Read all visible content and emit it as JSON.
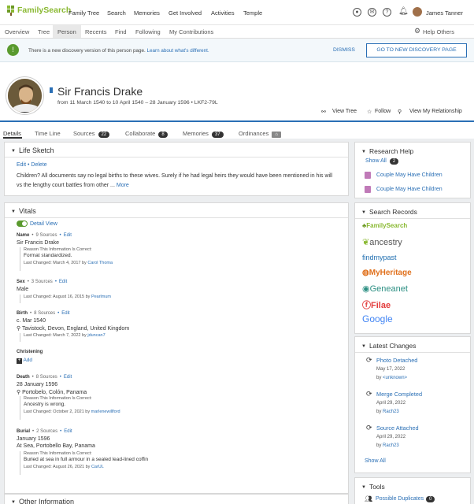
{
  "nav": {
    "logo": "FamilySearch",
    "items": [
      "Family Tree",
      "Search",
      "Memories",
      "Get Involved",
      "Activities",
      "Temple"
    ],
    "user": "James Tanner"
  },
  "subnav": {
    "items": [
      "Overview",
      "Tree",
      "Person",
      "Recents",
      "Find",
      "Following",
      "My Contributions"
    ],
    "help": "Help Others"
  },
  "banner": {
    "text": "There is a new discovery version of this person page.",
    "link": "Learn about what's different.",
    "dismiss": "DISMISS",
    "button": "GO TO NEW DISCOVERY PAGE"
  },
  "person": {
    "name": "Sir Francis Drake",
    "lifespan": "from 11 March 1540 to 10 April 1540 – 28 January 1596 • LKF2-79L",
    "actions": [
      "View Tree",
      "Follow",
      "View My Relationship"
    ]
  },
  "tabs": [
    {
      "label": "Details",
      "count": ""
    },
    {
      "label": "Time Line",
      "count": ""
    },
    {
      "label": "Sources",
      "count": "22"
    },
    {
      "label": "Collaborate",
      "count": "8"
    },
    {
      "label": "Memories",
      "count": "37"
    },
    {
      "label": "Ordinances",
      "count": ""
    }
  ],
  "life_sketch": {
    "title": "Life Sketch",
    "edit": "Edit",
    "delete": "Delete",
    "text": "Children? All documents say no legal births to these wives. Surely if he had legal heirs they would have been mentioned in his will vs the lengthy court battles from other ...",
    "more": "More"
  },
  "vitals": {
    "title": "Vitals",
    "detail_view": "Detail View",
    "name": {
      "label": "Name",
      "sources": "9 Sources",
      "edit": "Edit",
      "value": "Sir Francis Drake",
      "reason_label": "Reason This Information Is Correct:",
      "reason": "Format standardized.",
      "changed": "Last Changed: March 4, 2017 by",
      "by": "Carol Thoma"
    },
    "sex": {
      "label": "Sex",
      "sources": "3 Sources",
      "edit": "Edit",
      "value": "Male",
      "changed": "Last Changed: August 16, 2015 by",
      "by": "Pearlmum"
    },
    "birth": {
      "label": "Birth",
      "sources": "8 Sources",
      "edit": "Edit",
      "date": "c. Mar 1540",
      "place": "Tavistock, Devon, England, United Kingdom",
      "changed": "Last Changed: March 7, 2022 by",
      "by": "jduncan7"
    },
    "christening": {
      "label": "Christening",
      "add": "Add"
    },
    "death": {
      "label": "Death",
      "sources": "8 Sources",
      "edit": "Edit",
      "date": "28 January 1596",
      "place": "Portobelo, Colón, Panama",
      "reason_label": "Reason This Information Is Correct:",
      "reason": "Ancestry is wrong.",
      "changed": "Last Changed: October 2, 2021 by",
      "by": "marlenewillford"
    },
    "burial": {
      "label": "Burial",
      "sources": "2 Sources",
      "edit": "Edit",
      "date": "January 1596",
      "place": "At Sea, Portobello Bay, Panama",
      "reason_label": "Reason This Information Is Correct:",
      "reason": "Buried at sea in full armour in a sealed lead-lined coffin",
      "changed": "Last Changed: August 26, 2021 by",
      "by": "CarUL"
    }
  },
  "other_info": {
    "title": "Other Information"
  },
  "research_help": {
    "title": "Research Help",
    "show_all": "Show All",
    "count": "2",
    "items": [
      "Couple May Have Children",
      "Couple May Have Children"
    ]
  },
  "search_records": {
    "title": "Search Records",
    "sites": [
      "FamilySearch",
      "ancestry",
      "findmypast",
      "MyHeritage",
      "Geneanet",
      "Filae",
      "Google"
    ]
  },
  "latest_changes": {
    "title": "Latest Changes",
    "items": [
      {
        "title": "Photo Detached",
        "date": "May 17, 2022",
        "by_label": "by",
        "by": "<unknown>"
      },
      {
        "title": "Merge Completed",
        "date": "April 29, 2022",
        "by_label": "by",
        "by": "Rach23"
      },
      {
        "title": "Source Attached",
        "date": "April 29, 2022",
        "by_label": "by",
        "by": "Rach23"
      }
    ],
    "show_all": "Show All"
  },
  "tools": {
    "title": "Tools",
    "possible_duplicates": "Possible Duplicates",
    "count": "0"
  },
  "colors": {
    "accent": "#2a6fb5",
    "brand_green": "#8ab932"
  }
}
